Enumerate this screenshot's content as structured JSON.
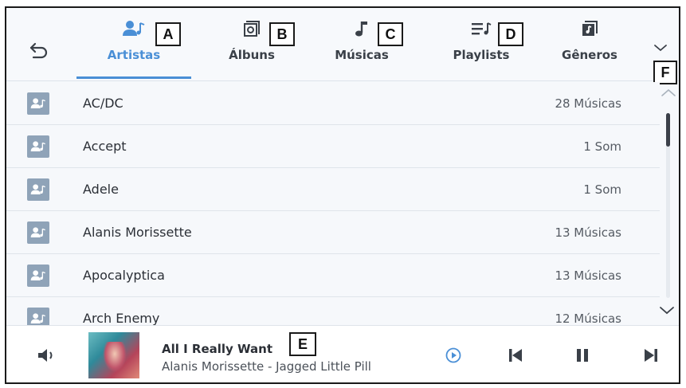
{
  "colors": {
    "accent": "#4a8fd6",
    "avatar_bg": "#8fa3b8",
    "text_primary": "#2b2f36",
    "text_secondary": "#555b63",
    "background": "#f6f8fb"
  },
  "header": {
    "back_icon": "back-arrow-icon",
    "expand_icon": "chevron-down-icon",
    "tabs": [
      {
        "label": "Artistas",
        "icon": "artist-icon",
        "active": true
      },
      {
        "label": "Álbuns",
        "icon": "album-icon",
        "active": false
      },
      {
        "label": "Músicas",
        "icon": "music-note-icon",
        "active": false
      },
      {
        "label": "Playlists",
        "icon": "playlist-icon",
        "active": false
      },
      {
        "label": "Gêneros",
        "icon": "genre-icon",
        "active": false
      }
    ]
  },
  "callouts": {
    "a": "A",
    "b": "B",
    "c": "C",
    "d": "D",
    "e": "E",
    "f": "F"
  },
  "list": {
    "rows": [
      {
        "name": "AC/DC",
        "count": "28 Músicas"
      },
      {
        "name": "Accept",
        "count": "1 Som"
      },
      {
        "name": "Adele",
        "count": "1 Som"
      },
      {
        "name": "Alanis Morissette",
        "count": "13 Músicas"
      },
      {
        "name": "Apocalyptica",
        "count": "13 Músicas"
      },
      {
        "name": "Arch Enemy",
        "count": "12 Músicas"
      }
    ]
  },
  "player": {
    "title": "All I Really Want",
    "subtitle": "Alanis Morissette - Jagged Little Pill",
    "volume_icon": "speaker-icon",
    "source_icon": "play-circle-icon",
    "prev_icon": "skip-previous-icon",
    "pause_icon": "pause-icon",
    "next_icon": "skip-next-icon"
  }
}
